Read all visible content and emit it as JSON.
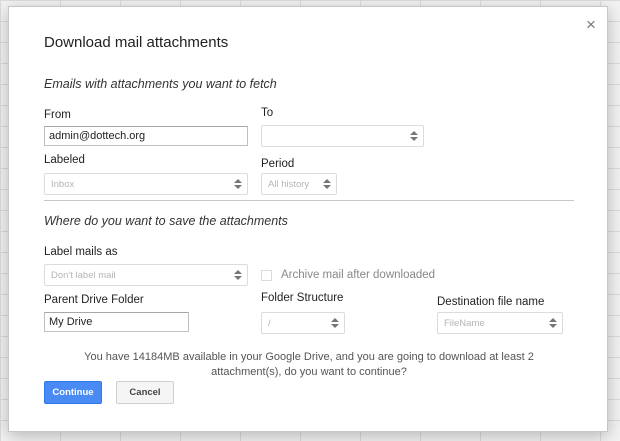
{
  "dialog": {
    "title": "Download mail attachments",
    "close_glyph": "×"
  },
  "section_fetch": {
    "heading": "Emails with attachments you want to fetch",
    "from_label": "From",
    "from_value": "admin@dottech.org",
    "to_label": "To",
    "to_value": "",
    "labeled_label": "Labeled",
    "labeled_value": "Inbox",
    "period_label": "Period",
    "period_value": "All history"
  },
  "section_save": {
    "heading": "Where do you want to save the attachments",
    "label_mails_label": "Label mails as",
    "label_mails_value": "Don't label mail",
    "archive_label": "Archive mail after downloaded",
    "archive_checked": false,
    "parent_folder_label": "Parent Drive Folder",
    "parent_folder_value": "My Drive",
    "folder_structure_label": "Folder Structure",
    "folder_structure_value": "/",
    "dest_filename_label": "Destination file name",
    "dest_filename_value": "FileName"
  },
  "notice": "You have 14184MB available in your Google Drive, and you are going to download at least 2 attachment(s), do you want to continue?",
  "buttons": {
    "continue": "Continue",
    "cancel": "Cancel"
  },
  "icons": {
    "select_arrows": "up-down-arrows-icon",
    "close": "close-icon"
  },
  "colors": {
    "primary_button": "#4a8af4",
    "dialog_bg": "#ffffff",
    "backdrop": "#f3f3f3"
  }
}
